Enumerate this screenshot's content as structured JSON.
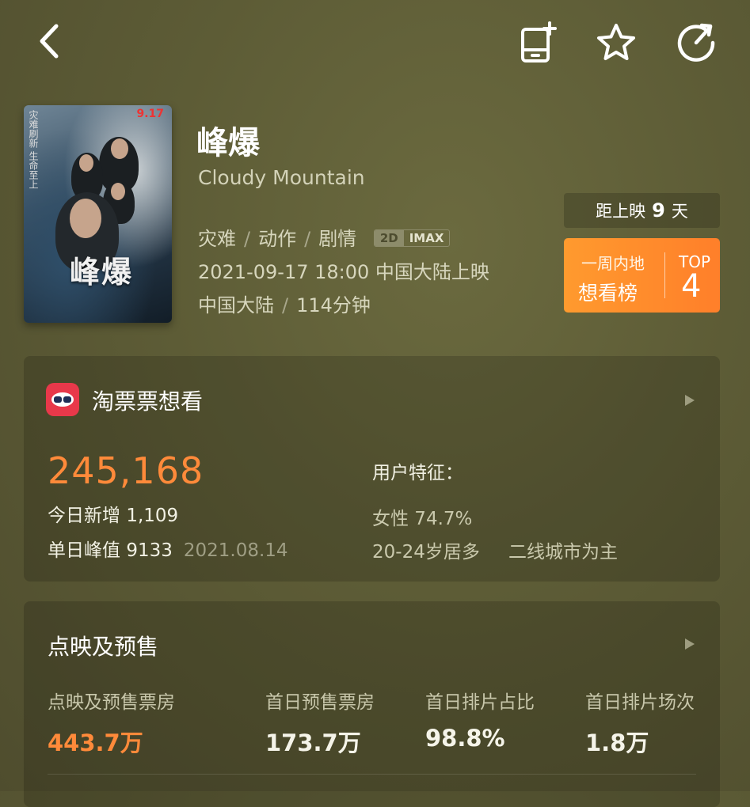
{
  "nav": {
    "back_icon": "chevron-left-icon",
    "add_calendar_icon": "add-to-calendar-icon",
    "favorite_icon": "star-outline-icon",
    "share_icon": "share-icon"
  },
  "movie": {
    "title_cn": "峰爆",
    "title_en": "Cloudy Mountain",
    "genres": [
      "灾难",
      "动作",
      "剧情"
    ],
    "formats": [
      "2D",
      "IMAX"
    ],
    "release": "2021-09-17 18:00 中国大陆上映",
    "region": "中国大陆",
    "duration": "114分钟",
    "poster": {
      "title": "峰爆",
      "date": "9.17",
      "tagline": "灾难刷新 生命至上"
    }
  },
  "countdown": {
    "prefix": "距上映",
    "days": "9",
    "suffix": "天"
  },
  "ranking": {
    "line1": "一周内地",
    "line2": "想看榜",
    "top_label": "TOP",
    "rank": "4"
  },
  "wish": {
    "title": "淘票票想看",
    "total": "245,168",
    "today_label": "今日新增",
    "today_value": "1,109",
    "peak_label": "单日峰值",
    "peak_value": "9133",
    "peak_date": "2021.08.14",
    "features_title": "用户特征：",
    "gender": "女性 74.7%",
    "age": "20-24岁居多",
    "city": "二线城市为主"
  },
  "presale": {
    "title": "点映及预售",
    "stats": [
      {
        "label": "点映及预售票房",
        "value": "443.7万"
      },
      {
        "label": "首日预售票房",
        "value": "173.7万"
      },
      {
        "label": "首日排片占比",
        "value": "98.8%"
      },
      {
        "label": "首日排片场次",
        "value": "1.8万"
      }
    ]
  },
  "colors": {
    "accent": "#ff8a3a",
    "background": "#5d5c36",
    "rank_badge": "#ff8a2c",
    "logo": "#e8384a"
  }
}
